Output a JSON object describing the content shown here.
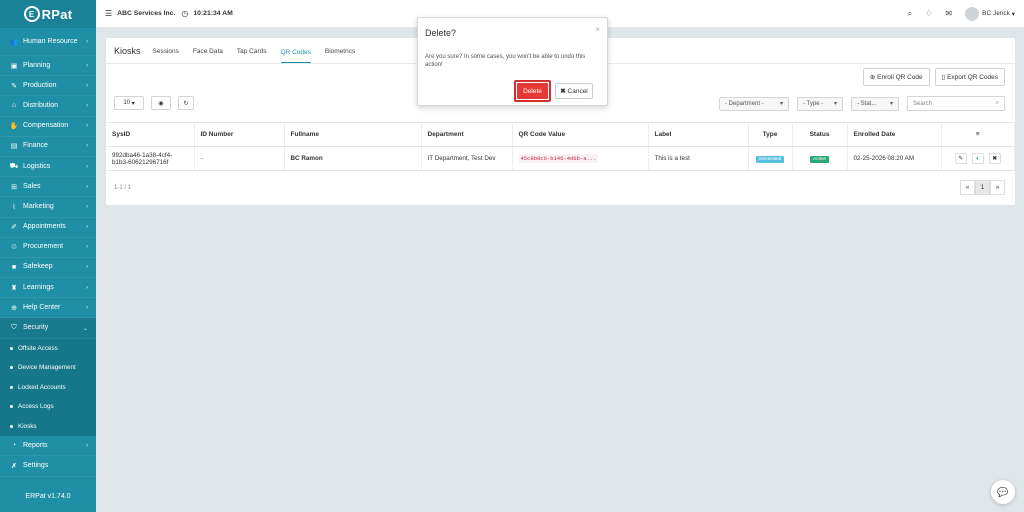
{
  "brand": {
    "logo_letter": "E",
    "name": "RPat",
    "version": "ERPat v1.74.0"
  },
  "topbar": {
    "menu_icon": "list-icon",
    "company": "ABC Services Inc.",
    "clock_icon": "clock-icon",
    "time": "10:21:34 AM",
    "user": "BC Jerick"
  },
  "sidebar": {
    "items": [
      {
        "label": "Human Resource",
        "icon": "users-icon",
        "glyph": "👥"
      },
      {
        "label": "Planning",
        "icon": "briefcase-icon",
        "glyph": "▣"
      },
      {
        "label": "Production",
        "icon": "wrench-icon",
        "glyph": "✎"
      },
      {
        "label": "Distribution",
        "icon": "bank-icon",
        "glyph": "⌂"
      },
      {
        "label": "Compensation",
        "icon": "handshake-icon",
        "glyph": "✋"
      },
      {
        "label": "Finance",
        "icon": "money-icon",
        "glyph": "▤"
      },
      {
        "label": "Logistics",
        "icon": "truck-icon",
        "glyph": "⛟"
      },
      {
        "label": "Sales",
        "icon": "cart-icon",
        "glyph": "⊞"
      },
      {
        "label": "Marketing",
        "icon": "chart-icon",
        "glyph": "⌇"
      },
      {
        "label": "Appointments",
        "icon": "edit-icon",
        "glyph": "✐"
      },
      {
        "label": "Procurement",
        "icon": "handshake-icon",
        "glyph": "♲"
      },
      {
        "label": "Safekeep",
        "icon": "box-icon",
        "glyph": "■"
      },
      {
        "label": "Learnings",
        "icon": "graduation-icon",
        "glyph": "♜"
      },
      {
        "label": "Help Center",
        "icon": "plus-circle-icon",
        "glyph": "⊕"
      },
      {
        "label": "Security",
        "icon": "shield-icon",
        "glyph": "⛉"
      }
    ],
    "security_sub": [
      "Offsite Access",
      "Device Management",
      "Locked Accounts",
      "Access Logs",
      "Kiosks"
    ],
    "bottom_items": [
      {
        "label": "Reports",
        "icon": "pie-icon",
        "glyph": "◔"
      },
      {
        "label": "Settings",
        "icon": "wrench-icon",
        "glyph": "✗"
      }
    ]
  },
  "page": {
    "title": "Kiosks",
    "tabs": [
      "Sessions",
      "Face Data",
      "Tap Cards",
      "QR Codes",
      "Biometrics"
    ],
    "active_tab": "QR Codes",
    "enroll_btn": "Enroll QR Code",
    "export_btn": "Export QR Codes",
    "page_size": "10",
    "filter_department": "- Department -",
    "filter_type": "- Type -",
    "filter_status": "- Stat...",
    "search_placeholder": "Search",
    "columns": [
      "SysID",
      "ID Number",
      "Fullname",
      "Department",
      "QR Code Value",
      "Label",
      "Type",
      "Status",
      "Enrolled Date",
      "≡"
    ],
    "rows": [
      {
        "sysid": "992dba46-1a38-4cf4-b1b3-60621296716f",
        "id_number": "-",
        "fullname": "BC Ramon",
        "department": "IT Department, Test Dev",
        "qr_value": "45c8b8c6-b146-4d6b-a...",
        "label": "This is a test",
        "type": "Generated",
        "status": "Active",
        "enrolled": "02-25-2026 08:20 AM"
      }
    ],
    "pager_info": "1-1 / 1",
    "pager": [
      "«",
      "1",
      "»"
    ]
  },
  "modal": {
    "title": "Delete?",
    "body": "Are you sure? In some cases, you won't be able to undo this action!",
    "delete_label": "Delete",
    "cancel_label": "Cancel"
  },
  "colors": {
    "sidebar": "#1f8fa5",
    "accent": "#1f8fa5",
    "danger": "#e53935",
    "type_badge": "#5bc0de",
    "status_badge": "#2aa876"
  }
}
